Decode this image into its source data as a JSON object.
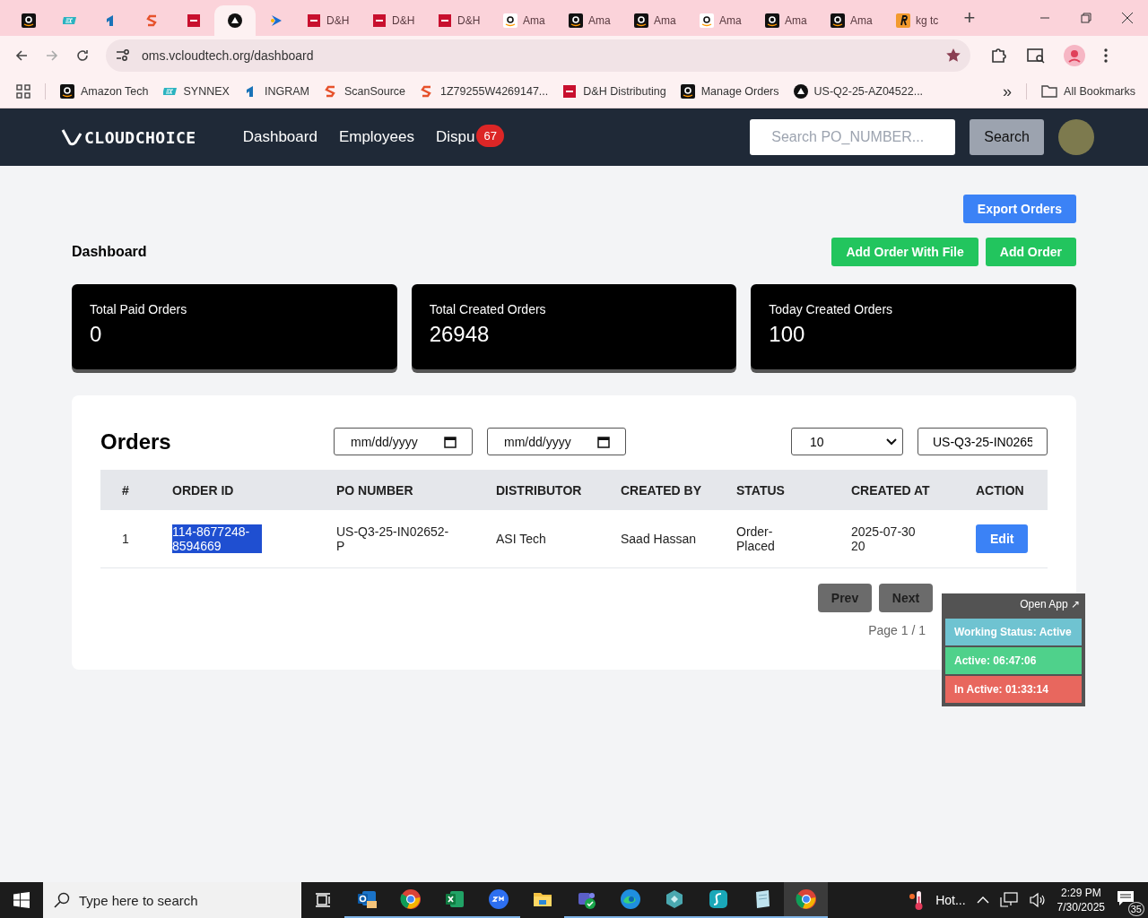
{
  "browser": {
    "tabs": [
      {
        "kind": "amazon",
        "selected": false
      },
      {
        "kind": "ec",
        "selected": false
      },
      {
        "kind": "ingram",
        "selected": false
      },
      {
        "kind": "scansource",
        "selected": false
      },
      {
        "kind": "dh",
        "selected": false
      },
      {
        "kind": "triangle",
        "selected": true
      },
      {
        "kind": "arrow",
        "selected": false
      },
      {
        "kind": "dh",
        "label": "D&H",
        "selected": false
      },
      {
        "kind": "dh",
        "label": "D&H",
        "selected": false
      },
      {
        "kind": "dh",
        "label": "D&H",
        "selected": false
      },
      {
        "kind": "amazon-light",
        "label": "Ama",
        "selected": false
      },
      {
        "kind": "amazon",
        "label": "Ama",
        "selected": false
      },
      {
        "kind": "amazon",
        "label": "Ama",
        "selected": false
      },
      {
        "kind": "amazon-light",
        "label": "Ama",
        "selected": false
      },
      {
        "kind": "amazon",
        "label": "Ama",
        "selected": false
      },
      {
        "kind": "amazon",
        "label": "Ama",
        "selected": false
      },
      {
        "kind": "r",
        "label": "kg tc",
        "selected": false
      }
    ],
    "new_tab": "+",
    "url": "oms.vcloudtech.org/dashboard",
    "bookmarked": true,
    "bookmarks": [
      {
        "kind": "amazon",
        "label": "Amazon Tech"
      },
      {
        "kind": "ec",
        "label": "SYNNEX"
      },
      {
        "kind": "ingram",
        "label": "INGRAM"
      },
      {
        "kind": "scansource",
        "label": "ScanSource"
      },
      {
        "kind": "scansource",
        "label": "1Z79255W4269147..."
      },
      {
        "kind": "dh",
        "label": "D&H Distributing"
      },
      {
        "kind": "amazon",
        "label": "Manage Orders"
      },
      {
        "kind": "triangle",
        "label": "US-Q2-25-AZ04522..."
      }
    ],
    "more": "»",
    "all_bookmarks": "All Bookmarks"
  },
  "navbar": {
    "logo": "CLOUDCHOICE",
    "links": [
      {
        "label": "Dashboard"
      },
      {
        "label": "Employees"
      },
      {
        "label": "Dispu",
        "badge": "67"
      }
    ],
    "search": {
      "placeholder": "Search PO_NUMBER..."
    },
    "search_button": "Search"
  },
  "page": {
    "export_button": "Export Orders",
    "title": "Dashboard",
    "buttons": [
      "Add Order With File",
      "Add Order"
    ],
    "cards": [
      {
        "label": "Total Paid Orders",
        "value": "0"
      },
      {
        "label": "Total Created Orders",
        "value": "26948"
      },
      {
        "label": "Today Created Orders",
        "value": "100"
      }
    ],
    "orders": {
      "title": "Orders",
      "date_from": {
        "placeholder": "mm/dd/yyyy"
      },
      "date_to": {
        "placeholder": "mm/dd/yyyy"
      },
      "page_size": "10",
      "search": {
        "value": "US-Q3-25-IN0265"
      },
      "columns": [
        "#",
        "ORDER ID",
        "PO NUMBER",
        "DISTRIBUTOR",
        "CREATED BY",
        "STATUS",
        "CREATED AT",
        "ACTION"
      ],
      "rows": [
        {
          "cells": [
            "1",
            "114-8677248-8594669",
            "US-Q3-25-IN02652-P",
            "ASI Tech",
            "Saad Hassan",
            "Order-Placed",
            "2025-07-30 20"
          ],
          "order_id_highlighted": true,
          "action": "Edit"
        }
      ],
      "prev": "Prev",
      "next": "Next",
      "page_label": "Page 1 / 1"
    }
  },
  "tracker": {
    "open_app": "Open App ↗",
    "rows": [
      {
        "text": "Working Status: Active",
        "color": "#6fc3d1"
      },
      {
        "text": "Active: 06:47:06",
        "color": "#4fd18b"
      },
      {
        "text": "In Active: 01:33:14",
        "color": "#e8675e"
      }
    ]
  },
  "taskbar": {
    "search": {
      "placeholder": "Type here to search"
    },
    "apps": [
      {
        "kind": "outlook",
        "running": true,
        "selected": false
      },
      {
        "kind": "chrome",
        "running": true,
        "selected": false
      },
      {
        "kind": "excel",
        "running": true,
        "selected": false
      },
      {
        "kind": "zoom",
        "running": true,
        "selected": false
      },
      {
        "kind": "explorer",
        "running": false,
        "selected": false
      },
      {
        "kind": "teams",
        "running": true,
        "selected": false
      },
      {
        "kind": "edge",
        "running": true,
        "selected": false
      },
      {
        "kind": "hexagon",
        "running": true,
        "selected": false
      },
      {
        "kind": "surfshark",
        "running": true,
        "selected": false
      },
      {
        "kind": "notepad",
        "running": true,
        "selected": false
      },
      {
        "kind": "chrome",
        "running": true,
        "selected": true
      }
    ],
    "weather": "Hot...",
    "time": "2:29 PM",
    "date": "7/30/2025",
    "notifications": "35"
  }
}
